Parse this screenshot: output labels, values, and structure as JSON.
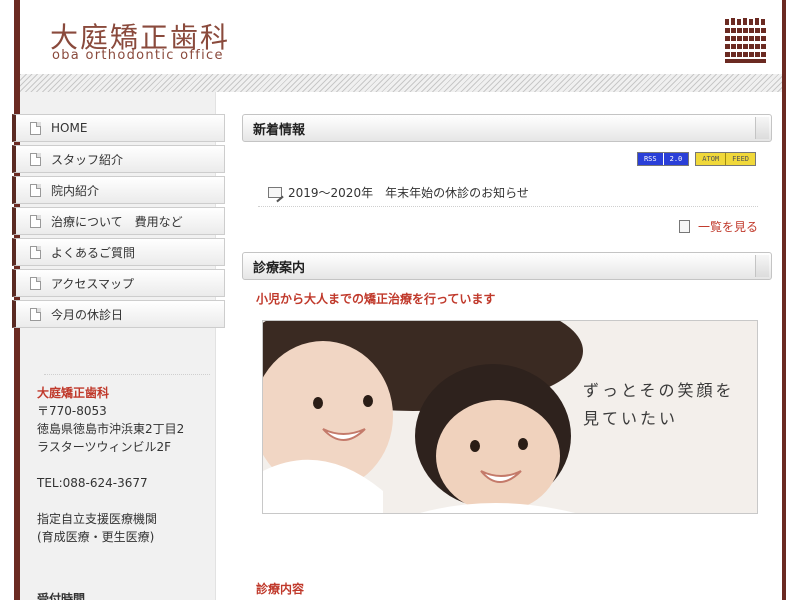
{
  "header": {
    "logo_jp": "大庭矯正歯科",
    "logo_en": "oba orthodontic office"
  },
  "nav": {
    "items": [
      {
        "label": "HOME"
      },
      {
        "label": "スタッフ紹介"
      },
      {
        "label": "院内紹介"
      },
      {
        "label": "治療について　費用など"
      },
      {
        "label": "よくあるご質問"
      },
      {
        "label": "アクセスマップ"
      },
      {
        "label": "今月の休診日"
      }
    ]
  },
  "clinic_info": {
    "name": "大庭矯正歯科",
    "postal": "〒770-8053",
    "address1": "徳島県徳島市沖浜東2丁目2",
    "address2": "ラスターツウィンビル2F",
    "tel": "TEL:088-624-3677",
    "designation1": "指定自立支援医療機関",
    "designation2": "(育成医療・更生医療)",
    "hours_heading": "受付時間"
  },
  "news": {
    "title": "新着情報",
    "rss": {
      "left": "RSS",
      "right": "2.0"
    },
    "atom": {
      "left": "ATOM",
      "right": "FEED"
    },
    "items": [
      {
        "text": "2019～2020年　年末年始の休診のお知らせ"
      }
    ],
    "more_label": "一覧を見る"
  },
  "consultation": {
    "title": "診療案内",
    "subtitle": "小児から大人までの矯正治療を行っています",
    "hero_caption_line1": "ずっとその笑顔を",
    "hero_caption_line2": "見ていたい",
    "next_heading": "診療内容"
  },
  "colors": {
    "brand": "#8a4a3c",
    "accent_red": "#c0392b",
    "frame_edge": "#6b2a22"
  }
}
